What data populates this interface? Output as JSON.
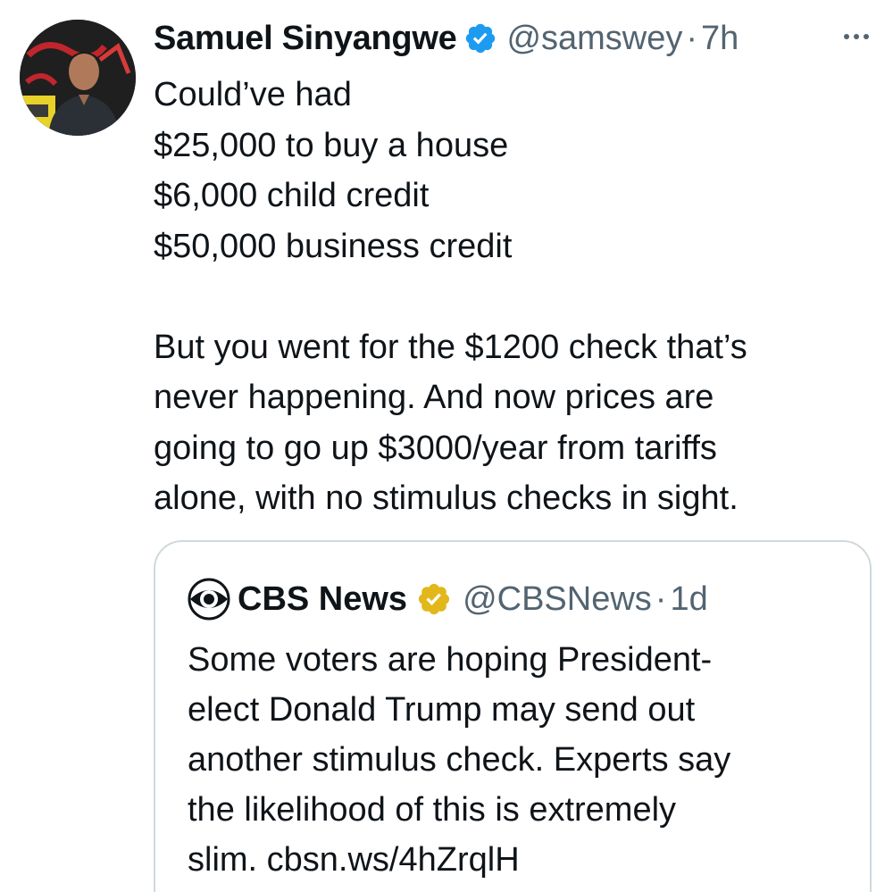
{
  "tweet": {
    "author": {
      "name": "Samuel Sinyangwe",
      "handle": "@samswey",
      "separator": "·",
      "time": "7h",
      "avatar_icon": "profile-photo"
    },
    "more_icon": "ellipsis-icon",
    "text_lines": [
      "Could’ve had",
      "$25,000 to buy a house",
      "$6,000 child credit",
      "$50,000 business credit",
      "",
      "But you went for the $1200 check that’s",
      "never happening. And now prices are",
      "going to go up $3000/year from tariffs",
      "alone, with no stimulus checks in sight."
    ],
    "colors": {
      "text": "#0f1419",
      "secondary": "#536471",
      "verified_blue": "#1d9bf0",
      "verified_gold": "#e2b719",
      "border": "#cfd9de"
    }
  },
  "quoted_tweet": {
    "author": {
      "name": "CBS News",
      "handle": "@CBSNews",
      "separator": "·",
      "time": "1d",
      "logo_icon": "cbs-eye-logo"
    },
    "text_lines": [
      "Some voters are hoping President-",
      "elect Donald Trump may send out",
      "another stimulus check. Experts say",
      "the likelihood of this is extremely",
      "slim. cbsn.ws/4hZrqlH"
    ]
  }
}
